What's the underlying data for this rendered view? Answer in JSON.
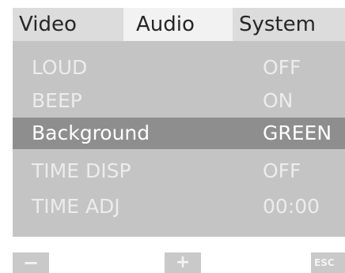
{
  "tabs": [
    {
      "label": "Video",
      "active": false
    },
    {
      "label": "Audio",
      "active": true
    },
    {
      "label": "System",
      "active": false
    }
  ],
  "settings": [
    {
      "label": "LOUD",
      "value": "OFF"
    },
    {
      "label": "BEEP",
      "value": "ON"
    },
    {
      "label": "Background",
      "value": "GREEN",
      "selected": true
    },
    {
      "label": "TIME DISP",
      "value": "OFF"
    },
    {
      "label": "TIME ADJ",
      "value": "00:00"
    }
  ],
  "buttons": {
    "minus": "−",
    "plus": "+",
    "esc": "ESC"
  },
  "colors": {
    "tab_bar": "#dcdcdc",
    "tab_active": "#f2f2f2",
    "panel": "#c4c4c4",
    "highlight": "#8e8e8e",
    "text_light": "#ececec"
  }
}
